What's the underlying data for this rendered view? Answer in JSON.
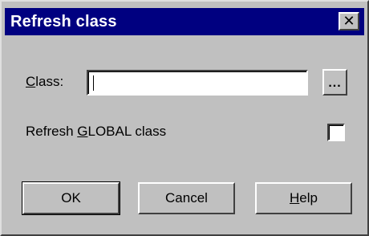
{
  "window": {
    "title": "Refresh class",
    "close_glyph": "✕",
    "close_icon": "close-icon"
  },
  "form": {
    "class_label_accel": "C",
    "class_label_rest": "lass:",
    "class_value": "",
    "browse_label": "...",
    "refresh_label_pre": "Refresh ",
    "refresh_label_accel": "G",
    "refresh_label_post": "LOBAL class",
    "refresh_checked": false
  },
  "buttons": {
    "ok": "OK",
    "cancel": "Cancel",
    "help_accel": "H",
    "help_rest": "elp"
  },
  "colors": {
    "titlebar": "#000080",
    "face": "#c0c0c0"
  }
}
